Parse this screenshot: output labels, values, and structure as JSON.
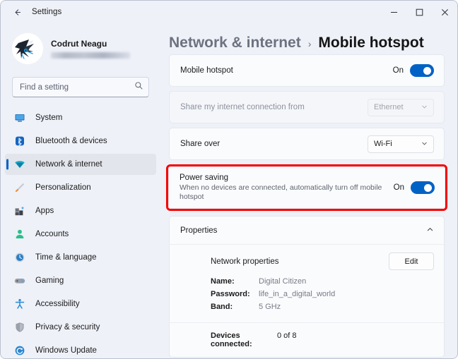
{
  "window": {
    "app_title": "Settings",
    "back_icon": "arrow-left-icon",
    "controls": {
      "minimize": "minimize-icon",
      "maximize": "maximize-icon",
      "close": "close-icon"
    }
  },
  "sidebar": {
    "account": {
      "name": "Codrut Neagu",
      "email_redacted": true,
      "avatar_icon": "user-avatar"
    },
    "search": {
      "placeholder": "Find a setting",
      "value": "",
      "icon": "search-icon"
    },
    "items": [
      {
        "label": "System",
        "icon": "monitor-icon",
        "selected": false
      },
      {
        "label": "Bluetooth & devices",
        "icon": "bluetooth-icon",
        "selected": false
      },
      {
        "label": "Network & internet",
        "icon": "wifi-icon",
        "selected": true
      },
      {
        "label": "Personalization",
        "icon": "paintbrush-icon",
        "selected": false
      },
      {
        "label": "Apps",
        "icon": "apps-icon",
        "selected": false
      },
      {
        "label": "Accounts",
        "icon": "person-icon",
        "selected": false
      },
      {
        "label": "Time & language",
        "icon": "clock-icon",
        "selected": false
      },
      {
        "label": "Gaming",
        "icon": "gamepad-icon",
        "selected": false
      },
      {
        "label": "Accessibility",
        "icon": "accessibility-icon",
        "selected": false
      },
      {
        "label": "Privacy & security",
        "icon": "shield-icon",
        "selected": false
      },
      {
        "label": "Windows Update",
        "icon": "update-icon",
        "selected": false
      }
    ]
  },
  "main": {
    "breadcrumb": {
      "parent": "Network & internet",
      "separator": "›",
      "current": "Mobile hotspot"
    },
    "mobile_hotspot": {
      "label": "Mobile hotspot",
      "toggle_state": "On",
      "toggle_on": true
    },
    "share_from": {
      "label": "Share my internet connection from",
      "value": "Ethernet",
      "disabled": true,
      "chevron_icon": "chevron-down-icon"
    },
    "share_over": {
      "label": "Share over",
      "value": "Wi-Fi",
      "disabled": false,
      "chevron_icon": "chevron-down-icon"
    },
    "power_saving": {
      "label": "Power saving",
      "description": "When no devices are connected, automatically turn off mobile hotspot",
      "toggle_state": "On",
      "toggle_on": true,
      "highlighted": true,
      "highlight_color": "#f60000"
    },
    "properties": {
      "title": "Properties",
      "expanded": true,
      "chevron_icon": "chevron-up-icon",
      "network_properties_label": "Network properties",
      "edit_label": "Edit",
      "fields": [
        {
          "key": "Name:",
          "value": "Digital Citizen"
        },
        {
          "key": "Password:",
          "value": "life_in_a_digital_world"
        },
        {
          "key": "Band:",
          "value": "5 GHz"
        }
      ],
      "devices_connected": {
        "key": "Devices connected:",
        "value": "0 of 8"
      }
    }
  },
  "theme": {
    "accent": "#0062c5",
    "window_bg": "#eef1f8",
    "card_bg": "#fafbfd"
  }
}
